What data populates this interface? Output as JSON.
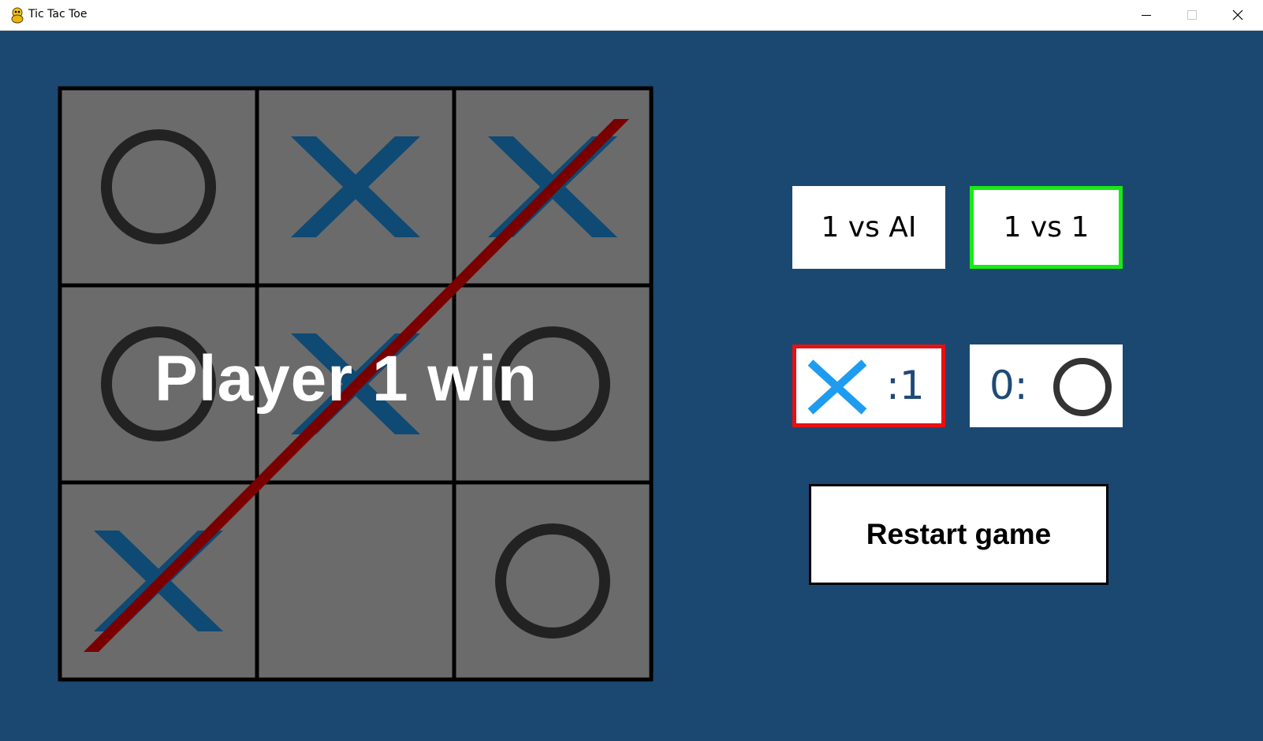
{
  "window": {
    "title": "Tic Tac Toe",
    "icon": "python-snake-icon",
    "controls": [
      "minimize-icon",
      "maximize-icon",
      "close-icon"
    ]
  },
  "board": {
    "cells": [
      "O",
      "X",
      "X",
      "O",
      "X",
      "O",
      "X",
      "",
      "O"
    ],
    "winning_line": "diagonal from bottom-left to top-right",
    "status_text": "Player 1 win"
  },
  "modes": {
    "vs_ai_label": "1 vs AI",
    "vs_player_label": "1 vs 1",
    "selected": "1 vs 1"
  },
  "score": {
    "x_label": ":1",
    "o_label": "0:"
  },
  "restart_label": "Restart game",
  "colors": {
    "background": "#1b4871",
    "cell": "#6b6b6b",
    "grid": "#000000",
    "x_mark": "#0e4a74",
    "o_mark": "#222222",
    "win_line": "#7a0000",
    "selected_mode_border": "#18ea14",
    "active_player_border": "#e81010",
    "score_x_icon": "#1e9cf0",
    "score_o_icon": "#333333"
  }
}
